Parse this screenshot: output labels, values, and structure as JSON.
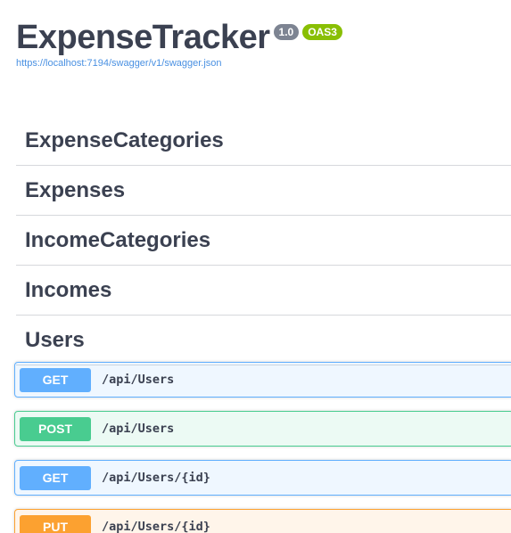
{
  "info": {
    "title": "ExpenseTracker",
    "version": "1.0",
    "oas": "OAS3",
    "spec_url": "https://localhost:7194/swagger/v1/swagger.json"
  },
  "tags": [
    {
      "label": "ExpenseCategories"
    },
    {
      "label": "Expenses"
    },
    {
      "label": "IncomeCategories"
    },
    {
      "label": "Incomes"
    },
    {
      "label": "Users"
    }
  ],
  "operations": [
    {
      "method": "GET",
      "path": "/api/Users"
    },
    {
      "method": "POST",
      "path": "/api/Users"
    },
    {
      "method": "GET",
      "path": "/api/Users/{id}"
    },
    {
      "method": "PUT",
      "path": "/api/Users/{id}"
    }
  ],
  "colors": {
    "get": "#61affe",
    "post": "#49cc90",
    "put": "#fca130",
    "version_badge": "#7d8492",
    "oas_badge": "#89bf04"
  }
}
